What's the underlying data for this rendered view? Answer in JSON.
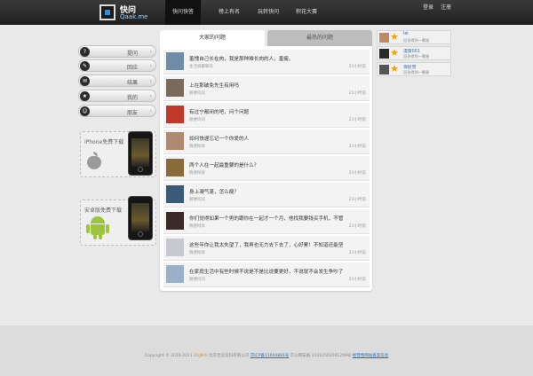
{
  "header": {
    "logo_cn": "快问",
    "logo_en": "Qaak.me",
    "nav": [
      "快问快答",
      "榜上有名",
      "玩转快问",
      "积花大赛"
    ],
    "login": "登录",
    "register": "注册"
  },
  "sidebar": {
    "menu": [
      {
        "label": "提问",
        "icon": "?"
      },
      {
        "label": "回应",
        "icon": "✎"
      },
      {
        "label": "结果",
        "icon": "✉"
      },
      {
        "label": "我的",
        "icon": "★"
      },
      {
        "label": "朋友",
        "icon": "☺"
      }
    ],
    "iphone_download": "iPhone免费下载",
    "android_download": "安卓版免费下载"
  },
  "feed": {
    "tabs": [
      "大家的问题",
      "最热的问题"
    ],
    "questions": [
      {
        "title": "羞愧自己长在肉，我是那种难长肉的人，羞瘦。",
        "sub": "生活很聚聊天",
        "time": "21小时前",
        "color": "#6f8ca8"
      },
      {
        "title": "上在那破免先生有用吗",
        "sub": "随便问问",
        "time": "21小时前",
        "color": "#7a6a5a"
      },
      {
        "title": "有过宁都闭的吧，问个问题",
        "sub": "随便问问",
        "time": "21小时前",
        "color": "#c0392b"
      },
      {
        "title": "如何快速忘记一个你爱的人",
        "sub": "情感倾诉",
        "time": "21小时前",
        "color": "#b08a70"
      },
      {
        "title": "两个人在一起最重要的是什么？",
        "sub": "情感倾诉",
        "time": "21小时前",
        "color": "#8a6a3a"
      },
      {
        "title": "身上凝气蓬，怎么瘦？",
        "sub": "随便问问",
        "time": "23小时前",
        "color": "#3a5a7a"
      },
      {
        "title": "你们觉得如果一个男的跟你在一起才一个月，他找我要钱买手机，不管",
        "sub": "情感倾诉",
        "time": "21小时前",
        "color": "#3a2a2a"
      },
      {
        "title": "这些年你让我太失望了，我再也无力去下去了，心好累！不知道还能坚",
        "sub": "情感倾诉",
        "time": "21小时前",
        "color": "#c8c8d0"
      },
      {
        "title": "在家庭生活中有些时候不说是不是比说要更好，不说就不会发生争吵了",
        "sub": "随便问问",
        "time": "21小时前",
        "color": "#9ab0c8"
      }
    ]
  },
  "users": [
    {
      "name": "lei",
      "desc": "回答得到一颗星",
      "color": "#c08a6a"
    },
    {
      "name": "漫雷001",
      "desc": "回答得到一颗星",
      "color": "#2a2a2a"
    },
    {
      "name": "保捉雪",
      "desc": "回答得到一颗星",
      "color": "#555555"
    }
  ],
  "footer": {
    "copyright": "Copyright © 2010-2011",
    "brand": "ZUJIHU",
    "company": "北京至远信科有限公司",
    "icp": "京ICP备11004881号",
    "police": "京公网安备 11010502001209号",
    "cert": "经营性网站备案信息"
  }
}
